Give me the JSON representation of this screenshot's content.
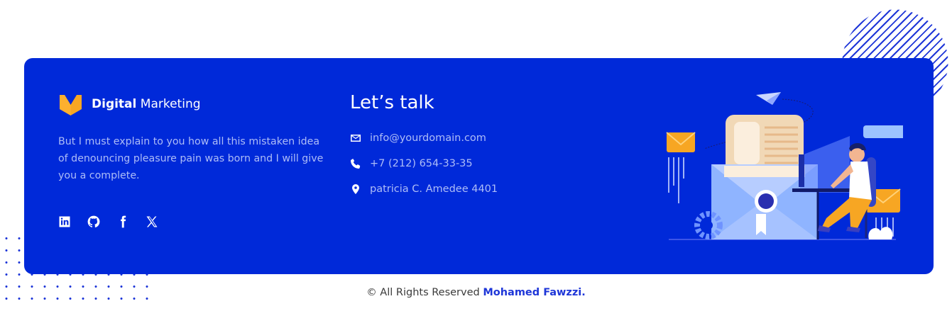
{
  "brand": {
    "name_bold": "Digital",
    "name_rest": " Marketing",
    "logo_color": "#f7a623"
  },
  "about": {
    "text": "But I must explain to you how all this mistaken idea of denouncing pleasure pain was born and I will give you a complete."
  },
  "socials": [
    "linkedin-icon",
    "github-icon",
    "facebook-icon",
    "x-icon"
  ],
  "contact": {
    "title": "Let’s talk",
    "email": "info@yourdomain.com",
    "phone": "+7 (212) 654-33-35",
    "address": "patricia C. Amedee 4401"
  },
  "footer": {
    "text": "© All Rights Reserved ",
    "author": "Mohamed Fawzzi."
  },
  "colors": {
    "card": "#0029d9",
    "accent": "#1e36d8",
    "muted_text": "#aebdf7"
  }
}
